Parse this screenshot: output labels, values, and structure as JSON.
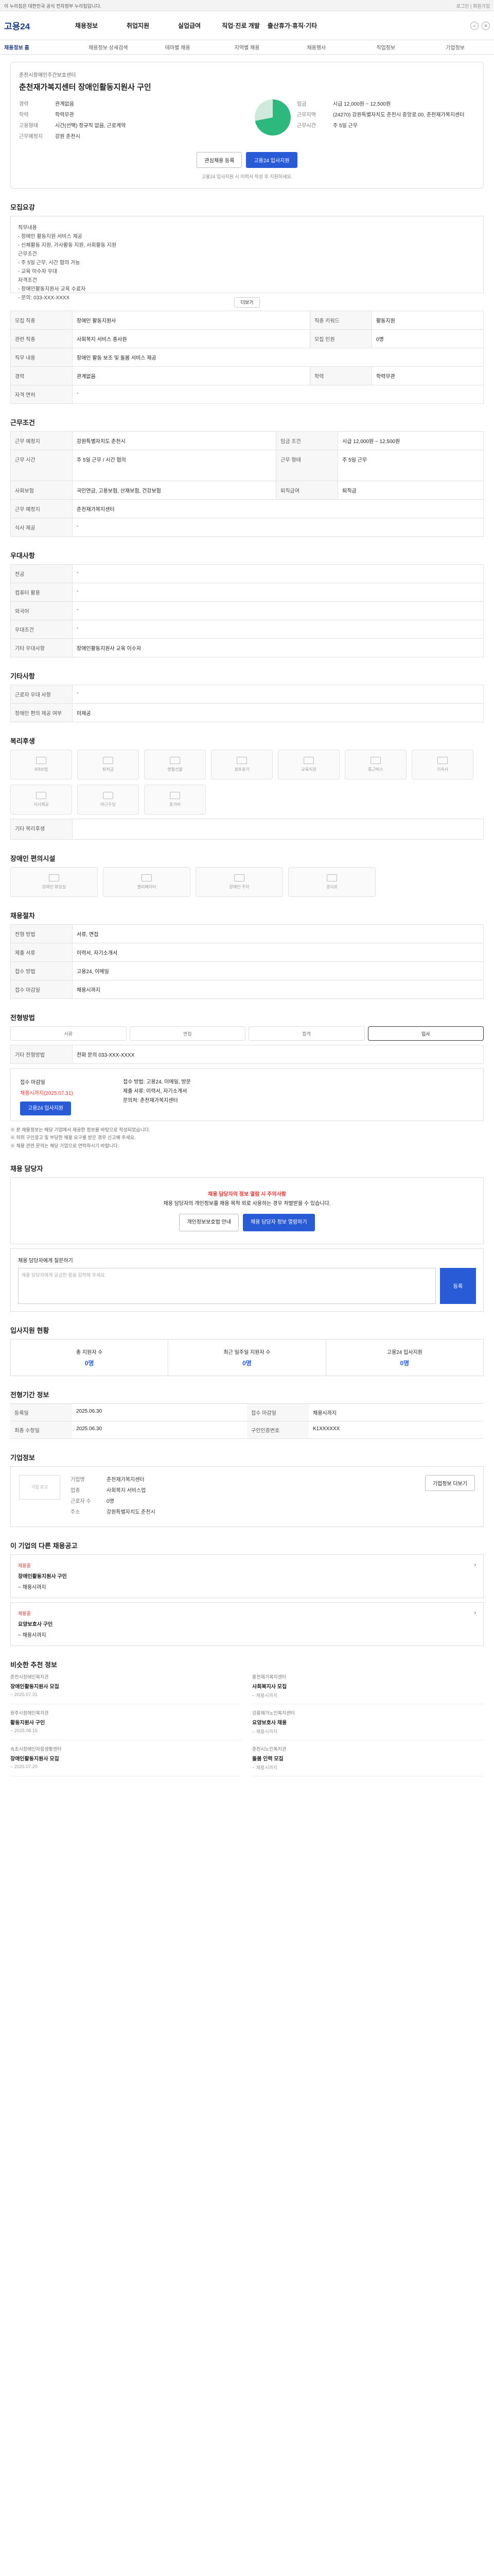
{
  "topbar": {
    "left": "이 누리집은 대한민국 공식 전자정부 누리집입니다.",
    "right": "로그인 | 회원가입"
  },
  "header": {
    "logo": "고용24",
    "gnb": [
      "채용정보",
      "취업지원",
      "실업급여",
      "직업·진로 개발",
      "출산휴가·휴직·기타"
    ]
  },
  "subtabs": [
    "채용정보 홈",
    "채용정보 상세검색",
    "테마별 채용",
    "지역별 채용",
    "채용행사",
    "직업정보",
    "기업정보"
  ],
  "job": {
    "company": "춘천시장애인주간보호센터",
    "title": "춘천재가복지센터 장애인활동지원사 구인",
    "summary_left": [
      {
        "k": "경력",
        "v": "관계없음"
      },
      {
        "k": "학력",
        "v": "학력무관"
      },
      {
        "k": "고용형태",
        "v": "시간(선택) 정규직 없음, 근로계약"
      },
      {
        "k": "근무예정지",
        "v": "강원 춘천시"
      }
    ],
    "summary_right": [
      {
        "k": "임금",
        "v": "시급 12,000원 ~ 12,500원"
      },
      {
        "k": "근무지역",
        "v": "(24270) 강원특별자치도 춘천시 중앙로 00, 춘천재가복지센터"
      },
      {
        "k": "근무시간",
        "v": "주 5일 근무"
      }
    ],
    "btn_scrap": "관심채용 등록",
    "btn_apply": "고용24 입사지원",
    "notice": "고용24 입사지원 시 이력서 작성 후 지원하세요."
  },
  "recruit": {
    "title": "모집요강",
    "body": "직무내용\n- 장애인 활동지원 서비스 제공\n- 신체활동 지원, 가사활동 지원, 사회활동 지원\n근무조건\n- 주 5일 근무, 시간 협의 가능\n- 교육 이수자 우대\n자격조건\n- 장애인활동지원사 교육 수료자\n- 문의: 033-XXX-XXXX",
    "more": "더보기"
  },
  "detail_table": {
    "rows": [
      [
        "모집 직종",
        "장애인 활동지원사",
        "직종 키워드",
        "활동지원"
      ],
      [
        "관련 직종",
        "사회복지 서비스 종사원",
        "모집 인원",
        "0명"
      ],
      [
        "직무 내용",
        "장애인 활동 보조 및 돌봄 서비스 제공",
        "",
        ""
      ],
      [
        "경력",
        "관계없음",
        "학력",
        "학력무관"
      ],
      [
        "자격 면허",
        "-",
        "",
        ""
      ]
    ]
  },
  "cond": {
    "title": "근무조건",
    "rows": [
      [
        "근무 예정지",
        "강원특별자치도 춘천시",
        "임금 조건",
        "시급 12,000원 ~ 12,500원"
      ],
      [
        "근무 시간",
        "주 5일 근무 / 시간 협의",
        "근무 형태",
        "주 5일 근무"
      ],
      [
        "사회보험",
        "국민연금, 고용보험, 산재보험, 건강보험",
        "퇴직급여",
        "퇴직금"
      ],
      [
        "근무 예정지",
        "춘천재가복지센터",
        "",
        ""
      ],
      [
        "식사 제공",
        "-",
        "",
        ""
      ]
    ]
  },
  "welfare": {
    "title": "우대사항",
    "rows": [
      [
        "전공",
        "-"
      ],
      [
        "컴퓨터 활용",
        "-"
      ],
      [
        "외국어",
        "-"
      ],
      [
        "우대조건",
        "-"
      ],
      [
        "기타 우대사항",
        "장애인활동지원사 교육 이수자"
      ]
    ]
  },
  "etc": {
    "title": "기타사항",
    "rows": [
      [
        "근로자 우대 사항",
        "-"
      ],
      [
        "장애인 편의 제공 여부",
        "미제공"
      ]
    ]
  },
  "welfare_icons": {
    "title": "복리후생",
    "items": [
      "4대보험",
      "퇴직금",
      "명절선물",
      "경조휴가",
      "교육지원",
      "통근버스",
      "기숙사",
      "식사제공",
      "야근수당",
      "휴가비"
    ],
    "note": "기타 복리후생"
  },
  "disabled_icons": {
    "title": "장애인 편의시설",
    "items": [
      "장애인 화장실",
      "엘리베이터",
      "장애인 주차",
      "경사로"
    ]
  },
  "process": {
    "title": "채용절차",
    "rows": [
      [
        "전형 방법",
        "서류, 면접"
      ],
      [
        "제출 서류",
        "이력서, 자기소개서"
      ],
      [
        "접수 방법",
        "고용24, 이메일"
      ],
      [
        "접수 마감일",
        "채용시까지"
      ]
    ]
  },
  "apply": {
    "title": "전형방법",
    "steps": [
      "서류",
      "면접",
      "합격",
      "입사"
    ],
    "contact": "기타 전형방법",
    "contact_v": "전화 문의 033-XXX-XXXX",
    "l_title": "접수 마감일",
    "l_value": "채용시까지(2025.07.31)",
    "l_btn": "고용24 입사지원",
    "r_lines": [
      "접수 방법: 고용24, 이메일, 방문",
      "제출 서류: 이력서, 자기소개서",
      "문의처: 춘천재가복지센터"
    ]
  },
  "notes": [
    "※ 본 채용정보는 해당 기업에서 제공한 정보를 바탕으로 작성되었습니다.",
    "※ 허위 구인광고 및 부당한 채용 요구를 받은 경우 신고해 주세요.",
    "※ 채용 관련 문의는 해당 기업으로 연락하시기 바랍니다."
  ],
  "qa": {
    "title": "채용 담당자",
    "notice": "채용 담당자의 정보 열람 시 주의사항",
    "body": "채용 담당자의 개인정보를 채용 목적 외로 사용하는 경우 처벌받을 수 있습니다.",
    "btn1": "개인정보보호법 안내",
    "btn2": "채용 담당자 정보 열람하기",
    "label": "채용 담당자에게 질문하기",
    "placeholder": "채용 담당자에게 궁금한 점을 입력해 주세요.",
    "submit": "등록"
  },
  "status": {
    "title": "입사지원 현황",
    "items": [
      [
        "총 지원자 수",
        "0명"
      ],
      [
        "최근 일주일 지원자 수",
        "0명"
      ],
      [
        "고용24 입사지원",
        "0명"
      ]
    ]
  },
  "info": {
    "title": "전형기간 정보",
    "rows": [
      [
        "등록일",
        "2025.06.30",
        "접수 마감일",
        "채용시까지"
      ],
      [
        "최종 수정일",
        "2025.06.30",
        "구인인증번호",
        "K1XXXXXX"
      ]
    ]
  },
  "company_info": {
    "title": "기업정보",
    "logo": "기업 로고",
    "rows": [
      [
        "기업명",
        "춘천재가복지센터"
      ],
      [
        "업종",
        "사회복지 서비스업"
      ],
      [
        "근로자 수",
        "0명"
      ],
      [
        "주소",
        "강원특별자치도 춘천시"
      ]
    ],
    "btn": "기업정보 더보기"
  },
  "related": {
    "title": "이 기업의 다른 채용공고",
    "items": [
      {
        "badge": "채용중",
        "title": "장애인활동지원사 구인",
        "d": "~ 채용시까지"
      },
      {
        "badge": "채용중",
        "title": "요양보호사 구인",
        "d": "~ 채용시까지"
      }
    ]
  },
  "recommend": {
    "title": "비슷한 추천 정보",
    "items": [
      {
        "c": "춘천시장애인복지관",
        "t": "장애인활동지원사 모집",
        "d": "~ 2025.07.31"
      },
      {
        "c": "홍천재가복지센터",
        "t": "사회복지사 모집",
        "d": "~ 채용시까지"
      },
      {
        "c": "원주시장애인복지관",
        "t": "활동지원사 구인",
        "d": "~ 2025.08.15"
      },
      {
        "c": "강릉재가노인복지센터",
        "t": "요양보호사 채용",
        "d": "~ 채용시까지"
      },
      {
        "c": "속초시장애인자립생활센터",
        "t": "장애인활동지원사 모집",
        "d": "~ 2025.07.20"
      },
      {
        "c": "춘천시노인복지관",
        "t": "돌봄 인력 모집",
        "d": "~ 채용시까지"
      }
    ]
  }
}
